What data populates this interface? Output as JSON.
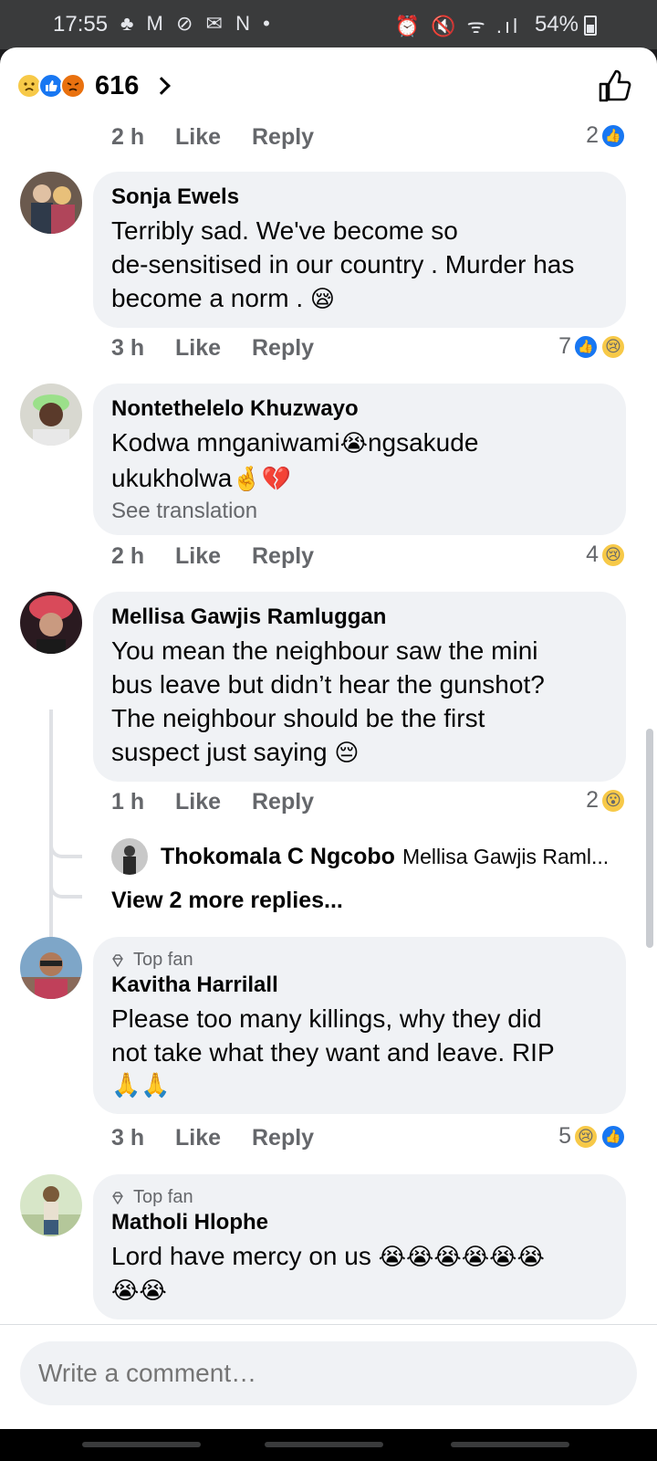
{
  "status_bar": {
    "time": "17:55",
    "left_icons": "♣ M ⊘ ✉ N •",
    "right_icons": "⏰ 🔇 ᯤ .ıl",
    "battery": "54%"
  },
  "header": {
    "reaction_icons": [
      "sad-icon",
      "like-icon",
      "angry-icon"
    ],
    "reaction_count": "616"
  },
  "comments": [
    {
      "id": "c0",
      "time": "2 h",
      "like_label": "Like",
      "reply_label": "Reply",
      "reaction_count": "2",
      "reactions": [
        "like"
      ]
    },
    {
      "id": "c1",
      "author": "Sonja Ewels",
      "lines": [
        "Terribly sad. We've become so",
        "de-sensitised in our country . Murder has",
        "become a norm ."
      ],
      "emoji": "😪",
      "time": "3 h",
      "like_label": "Like",
      "reply_label": "Reply",
      "reaction_count": "7",
      "reactions": [
        "like",
        "sad"
      ]
    },
    {
      "id": "c2",
      "author": "Nontethelelo Khuzwayo",
      "line1_a": "Kodwa mnganiwami",
      "line1_emoji": "😭",
      "line1_b": "ngsakude",
      "line2": "ukukholwa",
      "line2_emoji": "🤞💔",
      "see_translation": "See translation",
      "time": "2 h",
      "like_label": "Like",
      "reply_label": "Reply",
      "reaction_count": "4",
      "reactions": [
        "sad"
      ]
    },
    {
      "id": "c3",
      "author": "Mellisa Gawjis Ramluggan",
      "lines": [
        "You mean the neighbour saw the mini",
        "bus leave but didn’t hear the gunshot?",
        "The neighbour should be the first",
        "suspect just saying"
      ],
      "emoji": "😔",
      "time": "1 h",
      "like_label": "Like",
      "reply_label": "Reply",
      "reaction_count": "2",
      "reactions": [
        "wow"
      ],
      "reply_preview": {
        "author": "Thokomala C Ngcobo",
        "text": "Mellisa Gawjis Raml..."
      },
      "view_more": "View 2 more replies..."
    },
    {
      "id": "c4",
      "badge": "Top fan",
      "author": "Kavitha Harrilall",
      "lines": [
        "Please too many killings, why they did",
        "not take what they want and leave. RIP"
      ],
      "emoji_line": "🙏🙏",
      "time": "3 h",
      "like_label": "Like",
      "reply_label": "Reply",
      "reaction_count": "5",
      "reactions": [
        "sad",
        "like"
      ]
    },
    {
      "id": "c5",
      "badge": "Top fan",
      "author": "Matholi Hlophe",
      "text": "Lord have mercy on us",
      "emoji_line1": "😭😭😭😭😭😭",
      "emoji_line2": "😭😭"
    }
  ],
  "composer": {
    "placeholder": "Write a comment…"
  },
  "colors": {
    "facebook_blue": "#1877f2",
    "bubble_bg": "#f0f2f5",
    "secondary_text": "#65676b"
  }
}
